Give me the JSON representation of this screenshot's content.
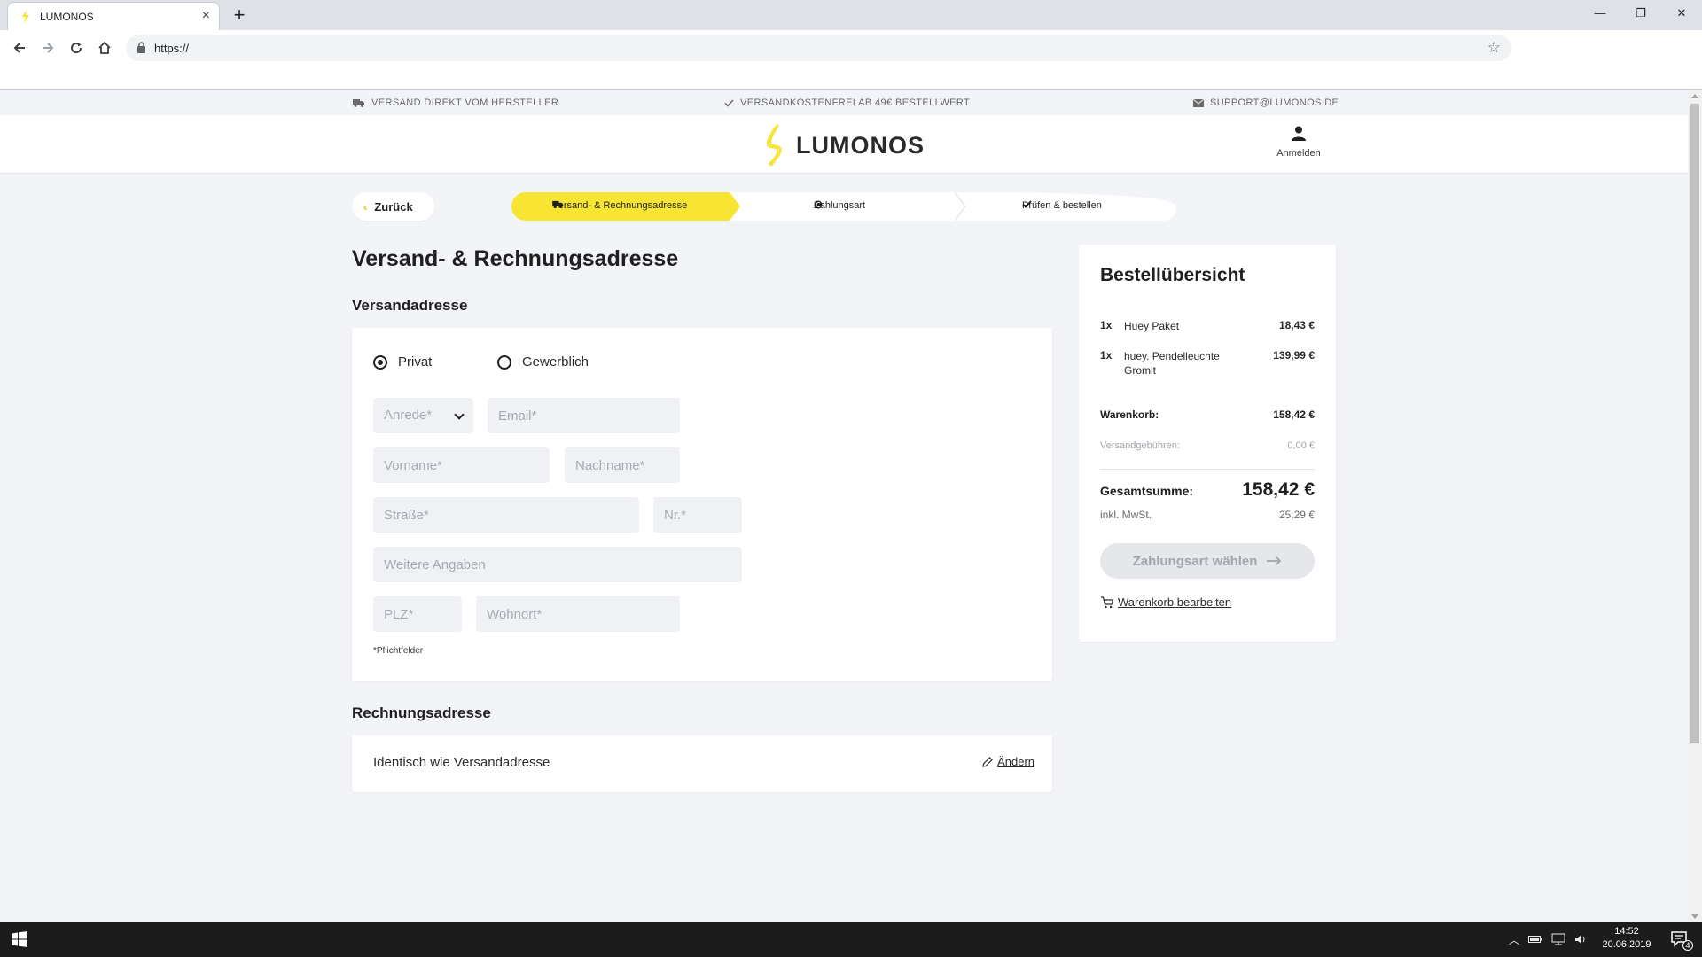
{
  "browser": {
    "tab_title": "LUMONOS",
    "tab_close": "×",
    "new_tab": "+",
    "url": "https://",
    "win_min": "—",
    "win_max": "❐",
    "win_close": "✕",
    "icons": [
      "arrow-left-icon",
      "arrow-right-icon",
      "reload-icon",
      "home-icon",
      "lock-icon",
      "star-icon"
    ]
  },
  "topbar": {
    "shipping": "VERSAND DIREKT VOM HERSTELLER",
    "free_shipping": "VERSANDKOSTENFREI AB 49€ BESTELLWERT",
    "email": "SUPPORT@LUMONOS.DE"
  },
  "header": {
    "logo": "LUMONOS",
    "account_label": "Anmelden",
    "brand_color": "#f7e433"
  },
  "steps": {
    "back": "Zurück",
    "items": [
      {
        "label": "Versand- & Rechnungsadresse",
        "active": true
      },
      {
        "label": "Zahlungsart",
        "active": false
      },
      {
        "label": "Prüfen & bestellen",
        "active": false
      }
    ]
  },
  "form": {
    "page_title": "Versand- & Rechnungsadresse",
    "shipping_title": "Versandadresse",
    "radio_private": "Privat",
    "radio_business": "Gewerblich",
    "selected": "Privat",
    "salutation": "Anrede*",
    "placeholders": {
      "email": "Email*",
      "firstname": "Vorname*",
      "lastname": "Nachname*",
      "street": "Straße*",
      "number": "Nr.*",
      "extra": "Weitere Angaben",
      "zip": "PLZ*",
      "city": "Wohnort*"
    },
    "required_hint": "*Pflichtfelder",
    "billing_title": "Rechnungsadresse",
    "billing_text": "Identisch wie Versandadresse",
    "change": "Ändern"
  },
  "summary": {
    "title": "Bestellübersicht",
    "items": [
      {
        "qty": "1x",
        "name": "Huey Paket",
        "price": "18,43 €"
      },
      {
        "qty": "1x",
        "name": "huey. Pendelleuchte Gromit",
        "price": "139,99 €"
      }
    ],
    "cart_label": "Warenkorb:",
    "cart_value": "158,42 €",
    "shipping_label": "Versandgebühren:",
    "shipping_value": "0,00 €",
    "total_label": "Gesamtsumme:",
    "total_value": "158,42 €",
    "vat_label": "inkl. MwSt.",
    "vat_value": "25,29 €",
    "cta": "Zahlungsart wählen",
    "edit_cart": "Warenkorb bearbeiten"
  },
  "taskbar": {
    "time": "14:52",
    "date": "20.06.2019",
    "notifications": "4"
  }
}
